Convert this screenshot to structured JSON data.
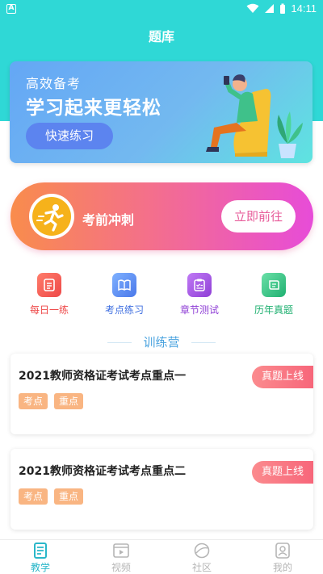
{
  "status_bar": {
    "time": "14:11",
    "app_badge": "A"
  },
  "header": {
    "title": "题库"
  },
  "banner": {
    "subtitle": "高效备考",
    "headline": "学习起来更轻松",
    "button_label": "快速练习"
  },
  "sprint": {
    "title": "考前冲刺",
    "button_label": "立即前往"
  },
  "quick_actions": [
    {
      "label": "每日一练",
      "icon": "calendar-icon",
      "color": "#f25b52",
      "label_color": "#ee4848"
    },
    {
      "label": "考点练习",
      "icon": "book-icon",
      "color": "#5a8df3",
      "label_color": "#3f6fe0"
    },
    {
      "label": "章节测试",
      "icon": "clipboard-icon",
      "color": "#a04fe0",
      "label_color": "#8f3fd6"
    },
    {
      "label": "历年真题",
      "icon": "scroll-icon",
      "color": "#3cc98a",
      "label_color": "#1fb070"
    }
  ],
  "section": {
    "title": "训练营"
  },
  "cards": [
    {
      "title": "2021教师资格证考试考点重点一",
      "tags": [
        "考点",
        "重点"
      ],
      "ribbon": "真题上线"
    },
    {
      "title": "2021教师资格证考试考点重点二",
      "tags": [
        "考点",
        "重点"
      ],
      "ribbon": "真题上线"
    }
  ],
  "tabs": [
    {
      "label": "教学",
      "icon": "teach-icon",
      "active": true
    },
    {
      "label": "视频",
      "icon": "video-icon",
      "active": false
    },
    {
      "label": "社区",
      "icon": "community-icon",
      "active": false
    },
    {
      "label": "我的",
      "icon": "profile-icon",
      "active": false
    }
  ],
  "colors": {
    "accent": "#2fd8d6",
    "tab_active": "#2ab7c9",
    "tab_inactive": "#b5b5b5"
  }
}
